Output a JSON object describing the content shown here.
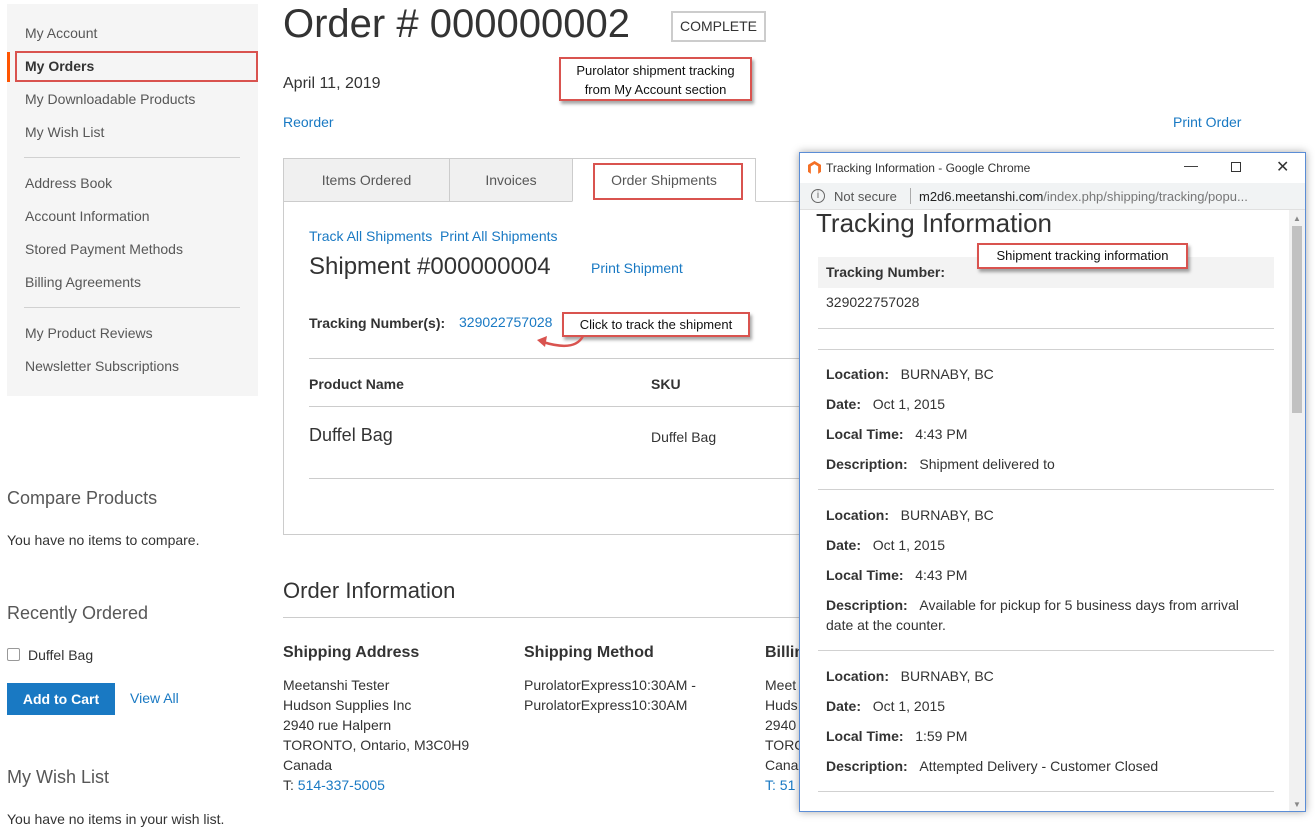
{
  "sidebar": {
    "items": [
      "My Account",
      "My Orders",
      "My Downloadable Products",
      "My Wish List",
      "Address Book",
      "Account Information",
      "Stored Payment Methods",
      "Billing Agreements",
      "My Product Reviews",
      "Newsletter Subscriptions"
    ],
    "compare_title": "Compare Products",
    "compare_text": "You have no items to compare.",
    "recent_title": "Recently Ordered",
    "recent_item": "Duffel Bag",
    "add_to_cart": "Add to Cart",
    "view_all": "View All",
    "wishlist_title": "My Wish List",
    "wishlist_text": "You have no items in your wish list."
  },
  "order": {
    "title": "Order # 000000002",
    "status": "COMPLETE",
    "date": "April 11, 2019",
    "reorder": "Reorder",
    "print_order": "Print Order",
    "tabs": [
      "Items Ordered",
      "Invoices",
      "Order Shipments"
    ],
    "track_all": "Track All Shipments",
    "print_all": "Print All Shipments",
    "shipment_title": "Shipment #000000004",
    "print_shipment": "Print Shipment",
    "tracking_label": "Tracking Number(s):",
    "tracking_number": "329022757028",
    "col_product": "Product Name",
    "col_sku": "SKU",
    "product_name": "Duffel Bag",
    "product_sku": "Duffel Bag",
    "info_title": "Order Information",
    "shipping_address_title": "Shipping Address",
    "shipping_address": [
      "Meetanshi Tester",
      "Hudson Supplies Inc",
      "2940 rue Halpern",
      "TORONTO, Ontario, M3C0H9",
      "Canada"
    ],
    "phone_prefix": "T:",
    "phone": "514-337-5005",
    "shipping_method_title": "Shipping Method",
    "shipping_method": [
      "PurolatorExpress10:30AM -",
      "PurolatorExpress10:30AM"
    ],
    "billing_title_partial": "Billin",
    "billing_partial": [
      "Meet",
      "Huds",
      "2940",
      "TORC",
      "Cana"
    ],
    "billing_phone_partial": "T: 51"
  },
  "callouts": {
    "top": [
      "Purolator shipment tracking",
      "from My Account section"
    ],
    "click": "Click to track the shipment",
    "info": "Shipment tracking information"
  },
  "popup": {
    "window_title": "Tracking Information - Google Chrome",
    "not_secure": "Not secure",
    "url_host": "m2d6.meetanshi.com",
    "url_path": "/index.php/shipping/tracking/popu...",
    "heading": "Tracking Information",
    "tracking_label": "Tracking Number:",
    "tracking_number": "329022757028",
    "labels": {
      "location": "Location:",
      "date": "Date:",
      "time": "Local Time:",
      "desc": "Description:"
    },
    "events": [
      {
        "location": "BURNABY, BC",
        "date": "Oct 1, 2015",
        "time": "4:43 PM",
        "desc": "Shipment delivered to",
        "desc2": ""
      },
      {
        "location": "BURNABY, BC",
        "date": "Oct 1, 2015",
        "time": "4:43 PM",
        "desc": "Available for pickup for 5 business days from arrival",
        "desc2": "date at the counter."
      },
      {
        "location": "BURNABY, BC",
        "date": "Oct 1, 2015",
        "time": "1:59 PM",
        "desc": "Attempted Delivery - Customer Closed",
        "desc2": ""
      }
    ]
  }
}
